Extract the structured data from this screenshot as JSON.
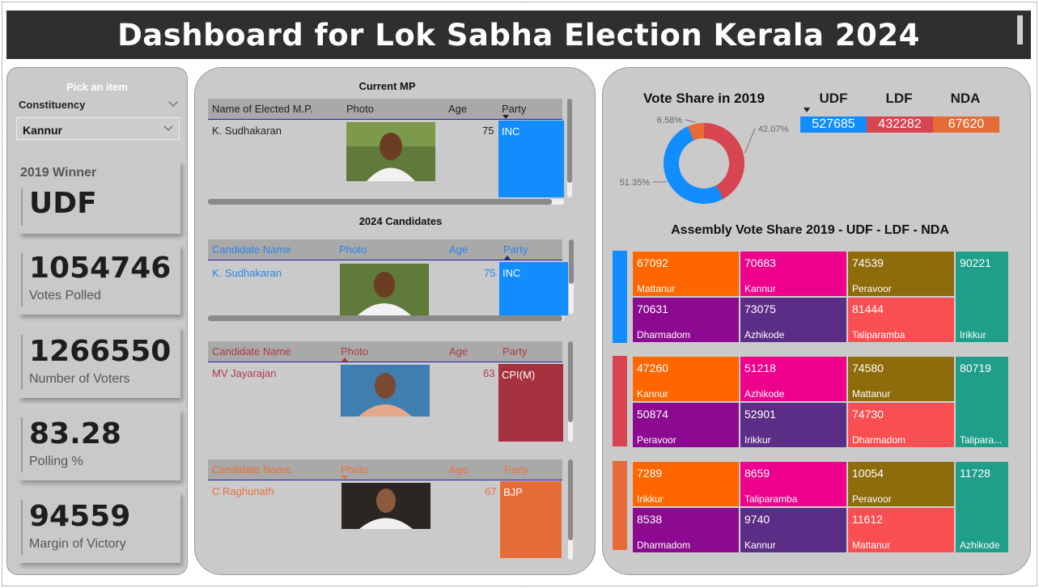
{
  "title": "Dashboard for Lok Sabha Election Kerala 2024",
  "slicer": {
    "heading": "Pick an item",
    "field": "Constituency",
    "value": "Kannur"
  },
  "cards": {
    "winner": {
      "caption": "2019 Winner",
      "value": "UDF"
    },
    "votes_polled": {
      "value": "1054746",
      "caption": "Votes Polled"
    },
    "voters": {
      "value": "1266550",
      "caption": "Number of Voters"
    },
    "polling": {
      "value": "83.28",
      "caption": "Polling %"
    },
    "margin": {
      "value": "94559",
      "caption": "Margin of Victory"
    }
  },
  "current_mp": {
    "title": "Current MP",
    "headers": [
      "Name of Elected M.P.",
      "Photo",
      "Age",
      "Party"
    ],
    "row": {
      "name": "K. Sudhakaran",
      "age": "75",
      "party": "INC"
    }
  },
  "candidates": {
    "title": "2024 Candidates",
    "tables": [
      {
        "headers": [
          "Candidate Name",
          "Photo",
          "Age",
          "Party"
        ],
        "name": "K. Sudhakaran",
        "age": "75",
        "party": "INC",
        "color": "#2a86e8",
        "party_color": "#118dff"
      },
      {
        "headers": [
          "Candidate Name",
          "Photo",
          "Age",
          "Party"
        ],
        "name": "MV Jayarajan",
        "age": "63",
        "party": "CPI(M)",
        "color": "#b03a48",
        "party_color": "#a6323f"
      },
      {
        "headers": [
          "Candidate Name",
          "Photo",
          "Age",
          "Party"
        ],
        "name": "C Raghunath",
        "age": "67",
        "party": "BJP",
        "color": "#e8713b",
        "party_color": "#e66c37"
      }
    ]
  },
  "vote_share_2019": {
    "title": "Vote Share in 2019",
    "parties": [
      {
        "name": "UDF",
        "votes": "527685",
        "color": "#118dff"
      },
      {
        "name": "LDF",
        "votes": "432282",
        "color": "#d64550"
      },
      {
        "name": "NDA",
        "votes": "67620",
        "color": "#e66c37"
      }
    ]
  },
  "chart_data": {
    "type": "pie",
    "title": "Vote Share in 2019",
    "categories": [
      "UDF",
      "LDF",
      "NDA"
    ],
    "values": [
      51.35,
      42.07,
      6.58
    ],
    "labels": [
      "51.35%",
      "42.07%",
      "6.58%"
    ],
    "colors": [
      "#118dff",
      "#d64550",
      "#e66c37"
    ]
  },
  "assembly": {
    "title": "Assembly Vote Share 2019 - UDF - LDF - NDA",
    "groups": [
      {
        "bar_color": "#118dff",
        "tiles": [
          {
            "value": "67092",
            "label": "Mattanur",
            "color": "#ff6600"
          },
          {
            "value": "70683",
            "label": "Kannur",
            "color": "#ec008c"
          },
          {
            "value": "74539",
            "label": "Peravoor",
            "color": "#8e6c0c"
          },
          {
            "value": "90221",
            "label": "Irikkur",
            "color": "#1f9e89"
          },
          {
            "value": "70631",
            "label": "Dharmadom",
            "color": "#8b0a8f"
          },
          {
            "value": "73075",
            "label": "Azhikode",
            "color": "#5b2d86"
          },
          {
            "value": "81444",
            "label": "Taliparamba",
            "color": "#fa4f52"
          }
        ]
      },
      {
        "bar_color": "#d64550",
        "tiles": [
          {
            "value": "47260",
            "label": "Kannur",
            "color": "#ff6600"
          },
          {
            "value": "51218",
            "label": "Azhikode",
            "color": "#ec008c"
          },
          {
            "value": "74580",
            "label": "Mattanur",
            "color": "#8e6c0c"
          },
          {
            "value": "80719",
            "label": "Talipara...",
            "color": "#1f9e89"
          },
          {
            "value": "50874",
            "label": "Peravoor",
            "color": "#8b0a8f"
          },
          {
            "value": "52901",
            "label": "Irikkur",
            "color": "#5b2d86"
          },
          {
            "value": "74730",
            "label": "Dharmadom",
            "color": "#fa4f52"
          }
        ]
      },
      {
        "bar_color": "#e66c37",
        "tiles": [
          {
            "value": "7289",
            "label": "Irikkur",
            "color": "#ff6600"
          },
          {
            "value": "8659",
            "label": "Taliparamba",
            "color": "#ec008c"
          },
          {
            "value": "10054",
            "label": "Peravoor",
            "color": "#8e6c0c"
          },
          {
            "value": "11728",
            "label": "Azhikode",
            "color": "#1f9e89"
          },
          {
            "value": "8538",
            "label": "Dharmadom",
            "color": "#8b0a8f"
          },
          {
            "value": "9740",
            "label": "Kannur",
            "color": "#5b2d86"
          },
          {
            "value": "11612",
            "label": "Mattanur",
            "color": "#fa4f52"
          }
        ]
      }
    ]
  }
}
